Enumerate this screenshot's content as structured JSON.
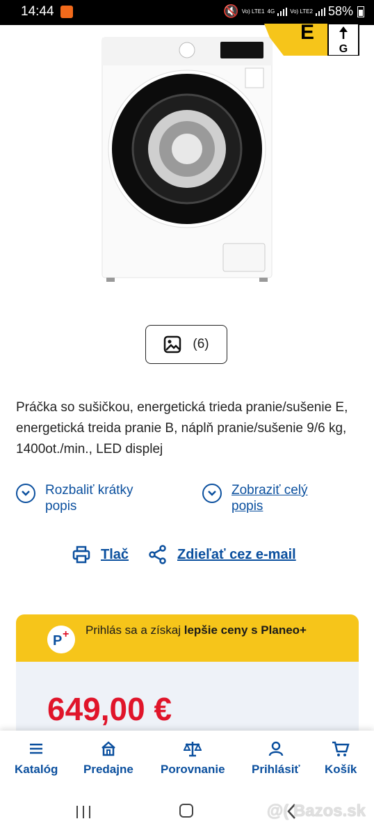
{
  "status_bar": {
    "time": "14:44",
    "network_1": "Vo) LTE1",
    "network_type": "4G",
    "network_2": "Vo) LTE2",
    "battery": "58%"
  },
  "energy_label": {
    "class_letter": "E",
    "scale_bottom": "G"
  },
  "gallery": {
    "count": "(6)"
  },
  "product": {
    "description": "Práčka so sušičkou, energetická trieda pranie/sušenie E, energetická treida pranie B, náplň pranie/sušenie 9/6 kg, 1400ot./min., LED displej"
  },
  "links": {
    "expand_short": "Rozbaliť krátky popis",
    "show_full": "Zobraziť celý popis"
  },
  "actions": {
    "print": "Tlač",
    "share": "Zdieľať cez e-mail"
  },
  "plus_banner": {
    "text_prefix": "Prihlás sa a získaj ",
    "text_bold": "lepšie ceny s Planeo+"
  },
  "price": {
    "value": "649,00 €"
  },
  "bottom_nav": [
    {
      "label": "Katalóg",
      "icon": "menu-icon"
    },
    {
      "label": "Predajne",
      "icon": "store-icon"
    },
    {
      "label": "Porovnanie",
      "icon": "scale-icon"
    },
    {
      "label": "Prihlásiť",
      "icon": "user-icon"
    },
    {
      "label": "Košík",
      "icon": "cart-icon"
    }
  ],
  "watermark": "@( Bazos.sk",
  "colors": {
    "accent_blue": "#0a4f9e",
    "banner_yellow": "#f6c51a",
    "price_red": "#e0152a"
  }
}
